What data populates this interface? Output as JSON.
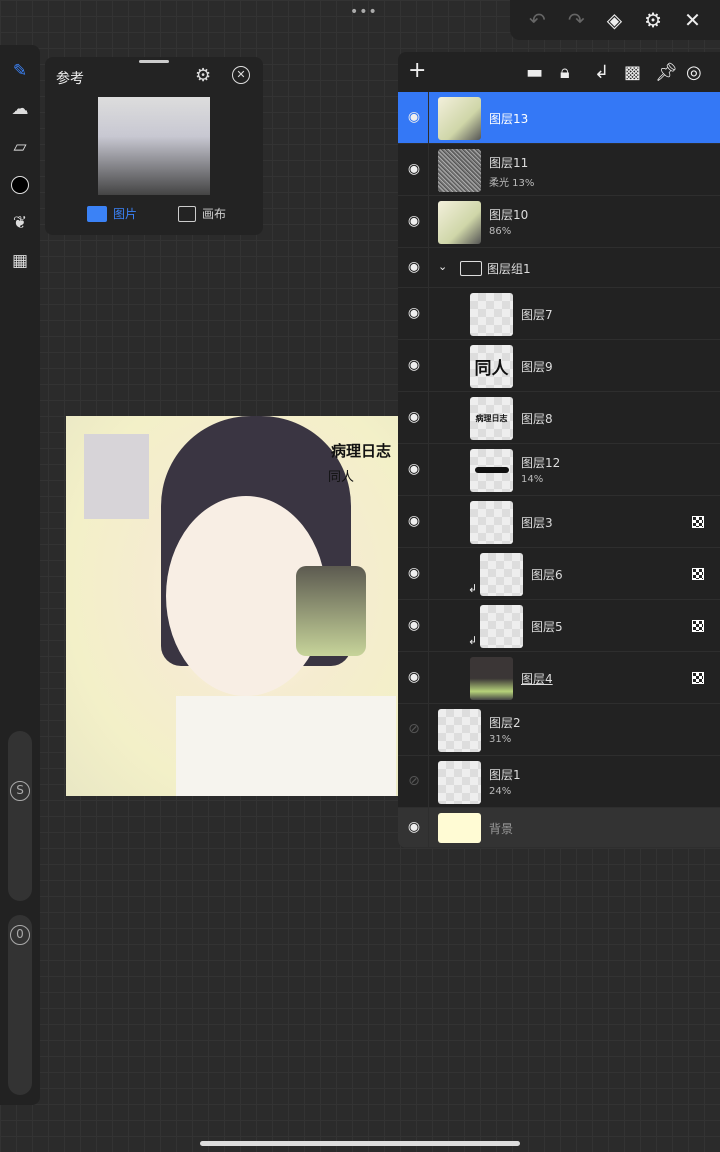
{
  "top": {
    "more": "•••",
    "undo": "undo",
    "redo": "redo"
  },
  "reference": {
    "title": "参考",
    "tabs": [
      {
        "label": "图片",
        "active": true
      },
      {
        "label": "画布",
        "active": false
      }
    ]
  },
  "canvas": {
    "text1": "病理日志",
    "text2": "同人"
  },
  "left_sliders": {
    "size_label": "S",
    "opacity_label": "0"
  },
  "layers": [
    {
      "name": "图层13",
      "selected": true,
      "thumb": "art"
    },
    {
      "name": "图层11",
      "sub": "柔光   13%",
      "thumb": "noise"
    },
    {
      "name": "图层10",
      "sub": "86%",
      "thumb": "art"
    },
    {
      "name": "图层组1",
      "group": true
    },
    {
      "name": "图层7",
      "indent": 1
    },
    {
      "name": "图层9",
      "indent": 1,
      "thumb_text": "同人"
    },
    {
      "name": "图层8",
      "indent": 1,
      "thumb_text": "病理日志"
    },
    {
      "name": "图层12",
      "sub": "14%",
      "indent": 1,
      "thumb": "stroke"
    },
    {
      "name": "图层3",
      "indent": 1,
      "alpha_lock": true
    },
    {
      "name": "图层6",
      "indent": 2,
      "clipped": true,
      "alpha_lock": true
    },
    {
      "name": "图层5",
      "indent": 2,
      "clipped": true,
      "alpha_lock": true
    },
    {
      "name": "图层4",
      "indent": 1,
      "alpha_lock": true,
      "underline": true,
      "thumb": "hair"
    },
    {
      "name": "图层2",
      "sub": "31%",
      "hidden": true
    },
    {
      "name": "图层1",
      "sub": "24%",
      "hidden": true
    },
    {
      "name": "背景",
      "background": true
    }
  ],
  "colors": {
    "accent": "#3478f6",
    "background_layer": "#fffbd4"
  }
}
